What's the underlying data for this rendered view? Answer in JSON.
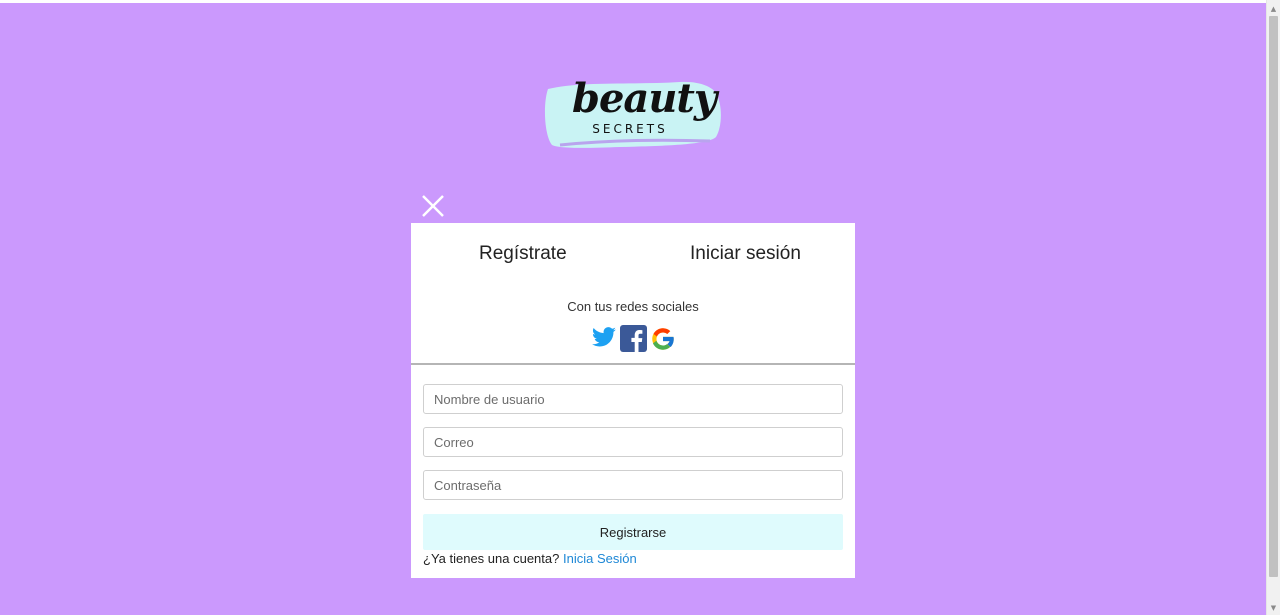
{
  "logo": {
    "script_text": "beauty",
    "sub_text": "SECRETS"
  },
  "modal": {
    "tabs": [
      {
        "label": "Regístrate"
      },
      {
        "label": "Iniciar sesión"
      }
    ],
    "social_caption": "Con tus redes sociales",
    "social_icons": [
      "twitter-icon",
      "facebook-icon",
      "google-icon"
    ],
    "fields": {
      "username": {
        "placeholder": "Nombre de usuario",
        "value": ""
      },
      "email": {
        "placeholder": "Correo",
        "value": ""
      },
      "password": {
        "placeholder": "Contraseña",
        "value": ""
      }
    },
    "submit_label": "Registrarse",
    "footer_text": "¿Ya tienes una cuenta?",
    "footer_link": "Inicia Sesión"
  },
  "colors": {
    "background": "#cb99fd",
    "modal": "#ffffff",
    "submit_button": "#dffbfd",
    "link": "#1e88d6",
    "logo_brush": "#c9f3f4"
  }
}
